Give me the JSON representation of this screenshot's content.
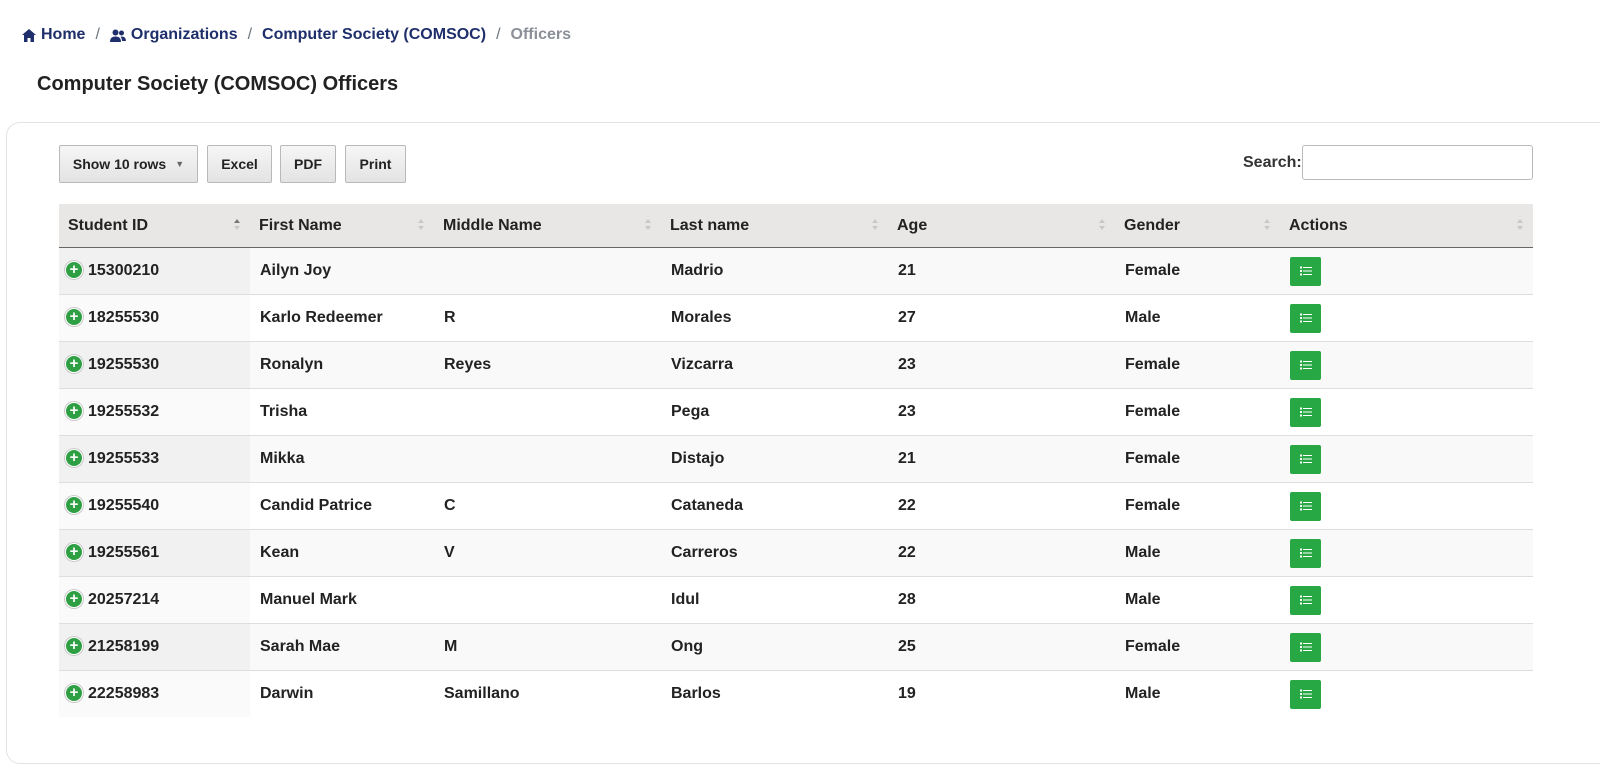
{
  "breadcrumb": {
    "home": "Home",
    "organizations": "Organizations",
    "org": "Computer Society (COMSOC)",
    "current": "Officers",
    "separator": "/"
  },
  "page": {
    "title": "Computer Society (COMSOC) Officers"
  },
  "toolbar": {
    "show_rows": "Show 10 rows",
    "excel": "Excel",
    "pdf": "PDF",
    "print": "Print",
    "search_label": "Search:",
    "search_value": ""
  },
  "table": {
    "columns": [
      "Student ID",
      "First Name",
      "Middle Name",
      "Last name",
      "Age",
      "Gender",
      "Actions"
    ],
    "rows": [
      {
        "id": "15300210",
        "first": "Ailyn Joy",
        "middle": "",
        "last": "Madrio",
        "age": "21",
        "gender": "Female"
      },
      {
        "id": "18255530",
        "first": "Karlo Redeemer",
        "middle": "R",
        "last": "Morales",
        "age": "27",
        "gender": "Male"
      },
      {
        "id": "19255530",
        "first": "Ronalyn",
        "middle": "Reyes",
        "last": "Vizcarra",
        "age": "23",
        "gender": "Female"
      },
      {
        "id": "19255532",
        "first": "Trisha",
        "middle": "",
        "last": "Pega",
        "age": "23",
        "gender": "Female"
      },
      {
        "id": "19255533",
        "first": "Mikka",
        "middle": "",
        "last": "Distajo",
        "age": "21",
        "gender": "Female"
      },
      {
        "id": "19255540",
        "first": "Candid Patrice",
        "middle": "C",
        "last": "Cataneda",
        "age": "22",
        "gender": "Female"
      },
      {
        "id": "19255561",
        "first": "Kean",
        "middle": "V",
        "last": "Carreros",
        "age": "22",
        "gender": "Male"
      },
      {
        "id": "20257214",
        "first": "Manuel Mark",
        "middle": "",
        "last": "Idul",
        "age": "28",
        "gender": "Male"
      },
      {
        "id": "21258199",
        "first": "Sarah Mae",
        "middle": "M",
        "last": "Ong",
        "age": "25",
        "gender": "Female"
      },
      {
        "id": "22258983",
        "first": "Darwin",
        "middle": "Samillano",
        "last": "Barlos",
        "age": "19",
        "gender": "Male"
      }
    ]
  },
  "colors": {
    "link": "#1e2f6b",
    "accent_green": "#28a745",
    "muted": "#8a8f98"
  },
  "icons": {
    "home": "home-icon",
    "organizations": "users-icon",
    "expand": "plus-circle-icon",
    "action": "list-icon"
  }
}
